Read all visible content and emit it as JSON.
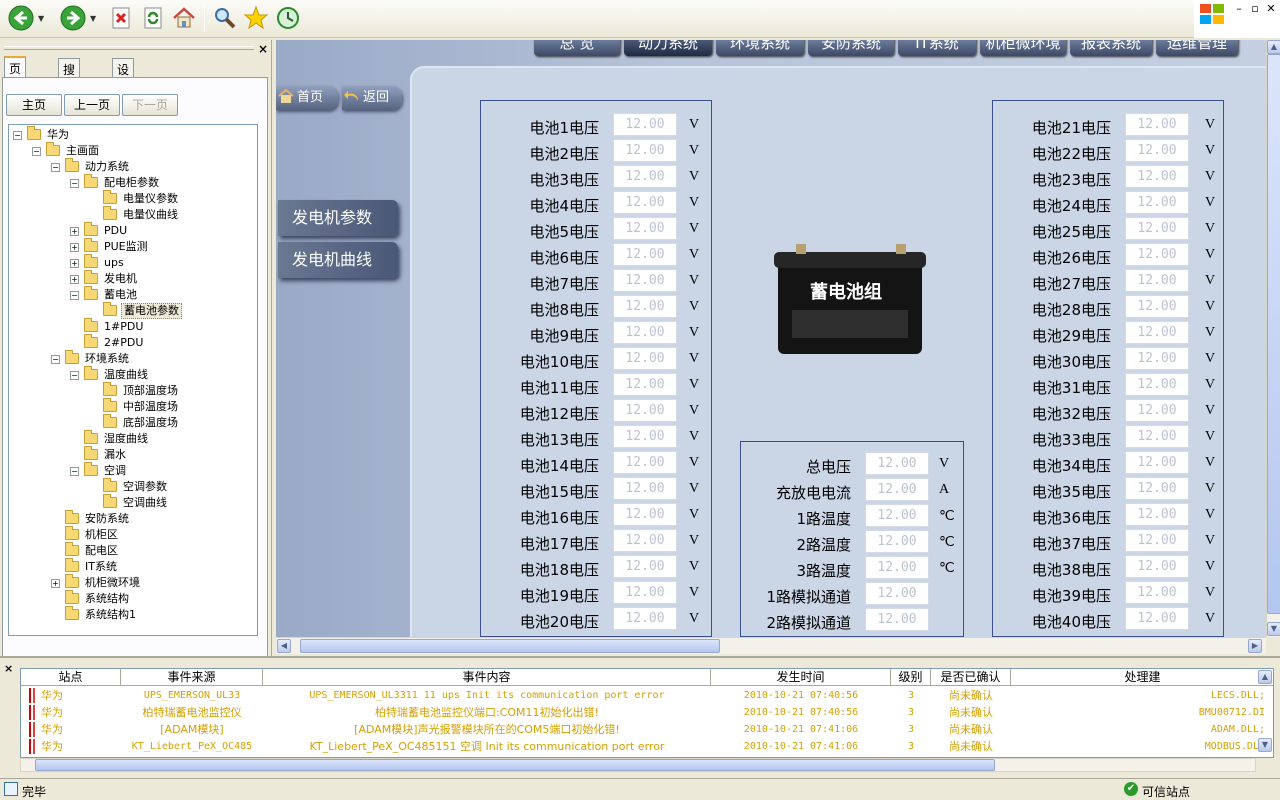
{
  "toolbar": {
    "items": [
      "back-icon",
      "forward-icon",
      "stop-icon",
      "refresh-icon",
      "home-icon",
      "search-icon",
      "favorites-icon",
      "history-icon"
    ]
  },
  "window_controls": {
    "minimize": "–",
    "restore": "▫",
    "close": "✕"
  },
  "left_panel": {
    "tabs": [
      "页面树",
      "搜索",
      "设备树"
    ],
    "nav": {
      "home": "主页",
      "prev": "上一页",
      "next": "下一页"
    },
    "tree": [
      {
        "label": "华为",
        "level": 0,
        "toggle": "−"
      },
      {
        "label": "主画面",
        "level": 1,
        "toggle": "−"
      },
      {
        "label": "动力系统",
        "level": 2,
        "toggle": "−"
      },
      {
        "label": "配电柜参数",
        "level": 3,
        "toggle": "−"
      },
      {
        "label": "电量仪参数",
        "level": 4,
        "toggle": ""
      },
      {
        "label": "电量仪曲线",
        "level": 4,
        "toggle": ""
      },
      {
        "label": "PDU",
        "level": 3,
        "toggle": "+"
      },
      {
        "label": "PUE监测",
        "level": 3,
        "toggle": "+"
      },
      {
        "label": "ups",
        "level": 3,
        "toggle": "+"
      },
      {
        "label": "发电机",
        "level": 3,
        "toggle": "+"
      },
      {
        "label": "蓄电池",
        "level": 3,
        "toggle": "−"
      },
      {
        "label": "蓄电池参数",
        "level": 4,
        "toggle": "",
        "selected": true
      },
      {
        "label": "1#PDU",
        "level": 3,
        "toggle": ""
      },
      {
        "label": "2#PDU",
        "level": 3,
        "toggle": ""
      },
      {
        "label": "环境系统",
        "level": 2,
        "toggle": "−"
      },
      {
        "label": "温度曲线",
        "level": 3,
        "toggle": "−"
      },
      {
        "label": "顶部温度场",
        "level": 4,
        "toggle": ""
      },
      {
        "label": "中部温度场",
        "level": 4,
        "toggle": ""
      },
      {
        "label": "底部温度场",
        "level": 4,
        "toggle": ""
      },
      {
        "label": "湿度曲线",
        "level": 3,
        "toggle": ""
      },
      {
        "label": "漏水",
        "level": 3,
        "toggle": ""
      },
      {
        "label": "空调",
        "level": 3,
        "toggle": "−"
      },
      {
        "label": "空调参数",
        "level": 4,
        "toggle": ""
      },
      {
        "label": "空调曲线",
        "level": 4,
        "toggle": ""
      },
      {
        "label": "安防系统",
        "level": 2,
        "toggle": ""
      },
      {
        "label": "机柜区",
        "level": 2,
        "toggle": ""
      },
      {
        "label": "配电区",
        "level": 2,
        "toggle": ""
      },
      {
        "label": "IT系统",
        "level": 2,
        "toggle": ""
      },
      {
        "label": "机柜微环境",
        "level": 2,
        "toggle": "+"
      },
      {
        "label": "系统结构",
        "level": 2,
        "toggle": ""
      },
      {
        "label": "系统结构1",
        "level": 2,
        "toggle": ""
      }
    ]
  },
  "main": {
    "top_nav": [
      "总 览",
      "动力系统",
      "环境系统",
      "安防系统",
      "IT系统",
      "机柜微环境",
      "报表系统",
      "运维管理"
    ],
    "active_nav": "动力系统",
    "home_button": "首页",
    "back_button": "返回",
    "side_buttons": [
      "发电机参数",
      "发电机曲线"
    ],
    "battery_image_label": "蓄电池组",
    "left_group": [
      {
        "label": "电池1电压",
        "value": "12.00",
        "unit": "V"
      },
      {
        "label": "电池2电压",
        "value": "12.00",
        "unit": "V"
      },
      {
        "label": "电池3电压",
        "value": "12.00",
        "unit": "V"
      },
      {
        "label": "电池4电压",
        "value": "12.00",
        "unit": "V"
      },
      {
        "label": "电池5电压",
        "value": "12.00",
        "unit": "V"
      },
      {
        "label": "电池6电压",
        "value": "12.00",
        "unit": "V"
      },
      {
        "label": "电池7电压",
        "value": "12.00",
        "unit": "V"
      },
      {
        "label": "电池8电压",
        "value": "12.00",
        "unit": "V"
      },
      {
        "label": "电池9电压",
        "value": "12.00",
        "unit": "V"
      },
      {
        "label": "电池10电压",
        "value": "12.00",
        "unit": "V"
      },
      {
        "label": "电池11电压",
        "value": "12.00",
        "unit": "V"
      },
      {
        "label": "电池12电压",
        "value": "12.00",
        "unit": "V"
      },
      {
        "label": "电池13电压",
        "value": "12.00",
        "unit": "V"
      },
      {
        "label": "电池14电压",
        "value": "12.00",
        "unit": "V"
      },
      {
        "label": "电池15电压",
        "value": "12.00",
        "unit": "V"
      },
      {
        "label": "电池16电压",
        "value": "12.00",
        "unit": "V"
      },
      {
        "label": "电池17电压",
        "value": "12.00",
        "unit": "V"
      },
      {
        "label": "电池18电压",
        "value": "12.00",
        "unit": "V"
      },
      {
        "label": "电池19电压",
        "value": "12.00",
        "unit": "V"
      },
      {
        "label": "电池20电压",
        "value": "12.00",
        "unit": "V"
      }
    ],
    "right_group": [
      {
        "label": "电池21电压",
        "value": "12.00",
        "unit": "V"
      },
      {
        "label": "电池22电压",
        "value": "12.00",
        "unit": "V"
      },
      {
        "label": "电池23电压",
        "value": "12.00",
        "unit": "V"
      },
      {
        "label": "电池24电压",
        "value": "12.00",
        "unit": "V"
      },
      {
        "label": "电池25电压",
        "value": "12.00",
        "unit": "V"
      },
      {
        "label": "电池26电压",
        "value": "12.00",
        "unit": "V"
      },
      {
        "label": "电池27电压",
        "value": "12.00",
        "unit": "V"
      },
      {
        "label": "电池28电压",
        "value": "12.00",
        "unit": "V"
      },
      {
        "label": "电池29电压",
        "value": "12.00",
        "unit": "V"
      },
      {
        "label": "电池30电压",
        "value": "12.00",
        "unit": "V"
      },
      {
        "label": "电池31电压",
        "value": "12.00",
        "unit": "V"
      },
      {
        "label": "电池32电压",
        "value": "12.00",
        "unit": "V"
      },
      {
        "label": "电池33电压",
        "value": "12.00",
        "unit": "V"
      },
      {
        "label": "电池34电压",
        "value": "12.00",
        "unit": "V"
      },
      {
        "label": "电池35电压",
        "value": "12.00",
        "unit": "V"
      },
      {
        "label": "电池36电压",
        "value": "12.00",
        "unit": "V"
      },
      {
        "label": "电池37电压",
        "value": "12.00",
        "unit": "V"
      },
      {
        "label": "电池38电压",
        "value": "12.00",
        "unit": "V"
      },
      {
        "label": "电池39电压",
        "value": "12.00",
        "unit": "V"
      },
      {
        "label": "电池40电压",
        "value": "12.00",
        "unit": "V"
      }
    ],
    "summary_group": [
      {
        "label": "总电压",
        "value": "12.00",
        "unit": "V"
      },
      {
        "label": "充放电电流",
        "value": "12.00",
        "unit": "A"
      },
      {
        "label": "1路温度",
        "value": "12.00",
        "unit": "℃"
      },
      {
        "label": "2路温度",
        "value": "12.00",
        "unit": "℃"
      },
      {
        "label": "3路温度",
        "value": "12.00",
        "unit": "℃"
      },
      {
        "label": "1路模拟通道",
        "value": "12.00",
        "unit": ""
      },
      {
        "label": "2路模拟通道",
        "value": "12.00",
        "unit": ""
      }
    ]
  },
  "events": {
    "columns": [
      "站点",
      "事件来源",
      "事件内容",
      "发生时间",
      "级别",
      "是否已确认",
      "处理建"
    ],
    "rows": [
      {
        "site": "华为",
        "source": "UPS_EMERSON_UL33",
        "content": "UPS_EMERSON_UL3311 11 ups Init its communication port error",
        "time": "2010-10-21 07:40:56",
        "level": "3",
        "ack": "尚未确认",
        "handler": "LECS.DLL;"
      },
      {
        "site": "华为",
        "source": "柏特瑞蓄电池监控仪",
        "content": "柏特瑞蓄电池监控仪端口:COM11初始化出错!",
        "time": "2010-10-21 07:40:56",
        "level": "3",
        "ack": "尚未确认",
        "handler": "BMU00712.DI"
      },
      {
        "site": "华为",
        "source": "[ADAM模块]",
        "content": "[ADAM模块]声光报警模块所在的COM5端口初始化错!",
        "time": "2010-10-21 07:41:06",
        "level": "3",
        "ack": "尚未确认",
        "handler": "ADAM.DLL;"
      },
      {
        "site": "华为",
        "source": "KT_Liebert_PeX_OC485",
        "content": "KT_Liebert_PeX_OC485151 空调 Init its communication port error",
        "time": "2010-10-21 07:41:06",
        "level": "3",
        "ack": "尚未确认",
        "handler": "MODBUS.DLL"
      }
    ]
  },
  "status": {
    "left": "完毕",
    "right": "可信站点"
  }
}
